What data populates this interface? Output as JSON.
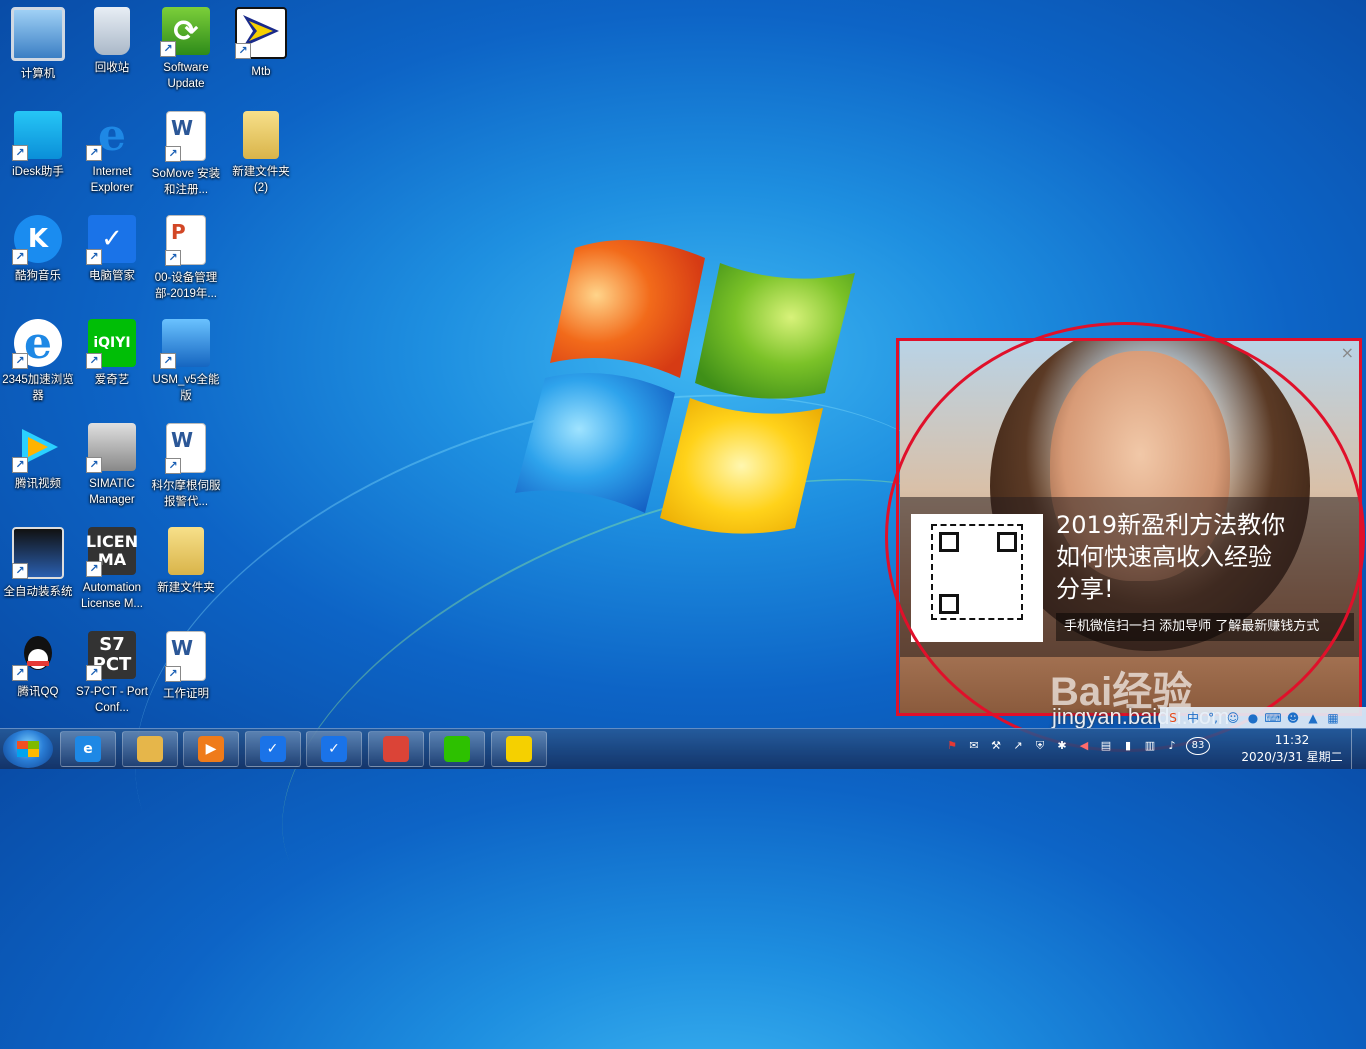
{
  "desktop": {
    "icons": [
      {
        "label": "计算机",
        "icon": "computer-icon"
      },
      {
        "label": "回收站",
        "icon": "recycle-bin-icon"
      },
      {
        "label": "Software Update",
        "icon": "software-update-icon"
      },
      {
        "label": "Mtb",
        "icon": "mtb-icon"
      },
      {
        "label": "iDesk助手",
        "icon": "idesk-icon"
      },
      {
        "label": "Internet Explorer",
        "icon": "internet-explorer-icon"
      },
      {
        "label": "SoMove 安装和注册...",
        "icon": "word-document-icon"
      },
      {
        "label": "新建文件夹 (2)",
        "icon": "folder-icon"
      },
      {
        "label": "酷狗音乐",
        "icon": "kugou-music-icon"
      },
      {
        "label": "电脑管家",
        "icon": "pc-manager-icon"
      },
      {
        "label": "00-设备管理部-2019年...",
        "icon": "powerpoint-document-icon"
      },
      {
        "label": "2345加速浏览器",
        "icon": "browser-2345-icon"
      },
      {
        "label": "爱奇艺",
        "icon": "iqiyi-icon"
      },
      {
        "label": "USM_v5全能版",
        "icon": "usm-icon"
      },
      {
        "label": "腾讯视频",
        "icon": "tencent-video-icon"
      },
      {
        "label": "SIMATIC Manager",
        "icon": "simatic-manager-icon"
      },
      {
        "label": "科尔摩根伺服报警代...",
        "icon": "word-document-icon"
      },
      {
        "label": "全自动装系统",
        "icon": "auto-install-icon"
      },
      {
        "label": "Automation License M...",
        "icon": "automation-license-icon"
      },
      {
        "label": "新建文件夹",
        "icon": "folder-icon"
      },
      {
        "label": "腾讯QQ",
        "icon": "qq-icon"
      },
      {
        "label": "S7-PCT - Port Conf...",
        "icon": "s7-pct-icon"
      },
      {
        "label": "工作证明",
        "icon": "word-document-icon"
      }
    ],
    "icon_glyph_text": {
      "iqiyi": "iQIYI",
      "licen": "LICEN",
      "ma": "MA",
      "s7": "S7",
      "pct": "PCT",
      "k": "K",
      "e": "e"
    }
  },
  "ad_popup": {
    "close_symbol": "×",
    "headline_line1": "2019新盈利方法教你",
    "headline_line2": "如何快速高收入经验",
    "headline_line3": "分享!",
    "subline": "手机微信扫一扫 添加导师 了解最新赚钱方式",
    "watermark_brand": "Bai经验",
    "watermark_url": "jingyan.baidu.com"
  },
  "taskbar": {
    "apps": [
      {
        "name": "internet-explorer",
        "glyph": "e",
        "color": "#1e88e5"
      },
      {
        "name": "file-explorer",
        "glyph": "",
        "color": "#e6b64a"
      },
      {
        "name": "media-player",
        "glyph": "▶",
        "color": "#ef7b1a"
      },
      {
        "name": "pc-manager-1",
        "glyph": "✓",
        "color": "#1a73e8"
      },
      {
        "name": "pc-manager-2",
        "glyph": "✓",
        "color": "#1a73e8"
      },
      {
        "name": "chrome",
        "glyph": "",
        "color": "#db4437"
      },
      {
        "name": "wechat",
        "glyph": "",
        "color": "#2dc100"
      },
      {
        "name": "mtb",
        "glyph": "",
        "color": "#f5d000"
      }
    ],
    "tray_badge": "83",
    "clock_time": "11:32",
    "clock_date": "2020/3/31 星期二"
  },
  "colors": {
    "annotation_red": "#e0102a",
    "taskbar_bg": "#1e3f70"
  }
}
